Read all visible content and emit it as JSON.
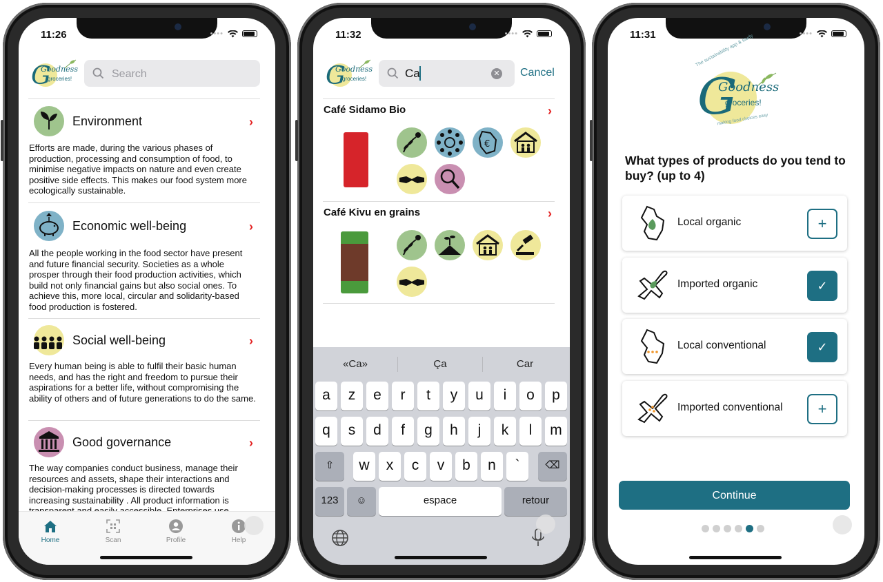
{
  "phone1": {
    "time": "11:26",
    "logo": {
      "word1": "Goodness",
      "word2": "groceries!"
    },
    "search_placeholder": "Search",
    "sections": [
      {
        "title": "Environment",
        "icon": "plant-hands-icon",
        "body": "Efforts are made, during the various phases of production, processing and consumption of food, to minimise negative impacts on nature and even create positive side effects. This makes our food system more ecologically sustainable."
      },
      {
        "title": "Economic well-being",
        "icon": "piggy-bank-icon",
        "body": "All the people working in the food sector have present and future financial security. Societies as a whole prosper through their food production activities, which build not only financial gains but also social ones. To achieve this, more local, circular and solidarity-based food production is fostered."
      },
      {
        "title": "Social well-being",
        "icon": "people-group-icon",
        "body": "Every human being is able to fulfil their basic human needs, and has the right and freedom to pursue their aspirations for a better life, without compromising the ability of others and of future generations to do the same."
      },
      {
        "title": "Good governance",
        "icon": "institution-icon",
        "body": "The way companies conduct business, manage their resources and assets, shape their interactions and decision-making processes is directed towards increasing sustainability . All product information is transparent and easily accessible. Enterprises use"
      }
    ],
    "tabs": [
      {
        "label": "Home",
        "icon": "home-icon"
      },
      {
        "label": "Scan",
        "icon": "qr-scan-icon"
      },
      {
        "label": "Profile",
        "icon": "profile-icon"
      },
      {
        "label": "Help",
        "icon": "info-icon"
      }
    ]
  },
  "phone2": {
    "time": "11:32",
    "search_value": "Ca",
    "cancel": "Cancel",
    "products": [
      {
        "name": "Café Sidamo Bio",
        "badges": [
          "bee-leaf-icon",
          "cooperation-circle-icon",
          "map-euro-icon",
          "home-family-icon",
          "handshake-icon",
          "magnifier-icon"
        ]
      },
      {
        "name": "Café Kivu en grains",
        "badges": [
          "bee-leaf-icon",
          "soil-plant-icon",
          "home-family-icon",
          "gavel-icon",
          "handshake-icon"
        ]
      }
    ],
    "suggestions": [
      "«Ca»",
      "Ça",
      "Car"
    ],
    "keyboard": {
      "row1": [
        "a",
        "z",
        "e",
        "r",
        "t",
        "y",
        "u",
        "i",
        "o",
        "p"
      ],
      "row2": [
        "q",
        "s",
        "d",
        "f",
        "g",
        "h",
        "j",
        "k",
        "l",
        "m"
      ],
      "row3": [
        "w",
        "x",
        "c",
        "v",
        "b",
        "n",
        "`"
      ],
      "num": "123",
      "space": "espace",
      "return": "retour"
    }
  },
  "phone3": {
    "time": "11:31",
    "logo": {
      "word1": "Goodness",
      "word2": "groceries!",
      "arc_top": "The sustainability app & study",
      "arc_bottom": "making food choices easy"
    },
    "question": "What types of products do you tend to buy? (up to 4)",
    "options": [
      {
        "label": "Local organic",
        "checked": false
      },
      {
        "label": "Imported organic",
        "checked": true
      },
      {
        "label": "Local conventional",
        "checked": true
      },
      {
        "label": "Imported conventional",
        "checked": false
      }
    ],
    "plus": "+",
    "check": "✓",
    "continue": "Continue",
    "page_count": 6,
    "page_active": 5
  },
  "colors": {
    "accent": "#1e6f83",
    "chevron": "#e32222",
    "badge_green": "#9fc48d",
    "badge_blue": "#7fb2c7",
    "badge_yellow": "#efe89a",
    "badge_pink": "#c98fb1"
  }
}
